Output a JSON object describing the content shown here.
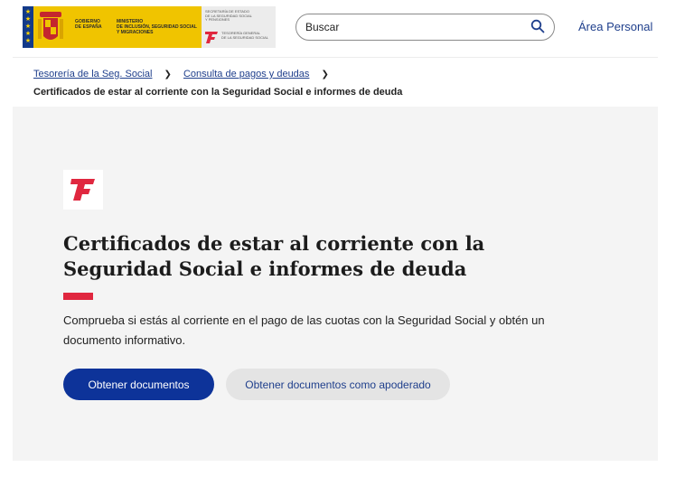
{
  "header": {
    "gobierno_text": [
      "GOBIERNO",
      "DE ESPAÑA"
    ],
    "ministerio_text": [
      "MINISTERIO",
      "DE INCLUSIÓN, SEGURIDAD SOCIAL",
      "Y MIGRACIONES"
    ],
    "secretaria_text": [
      "SECRETARÍA DE ESTADO",
      "DE LA SEGURIDAD SOCIAL",
      "Y PENSIONES"
    ],
    "tesoreria_text": [
      "TESORERÍA GENERAL",
      "DE LA SEGURIDAD SOCIAL"
    ],
    "search_placeholder": "Buscar",
    "area_personal": "Área Personal"
  },
  "breadcrumb": {
    "items": [
      "Tesorería de la Seg. Social",
      "Consulta de pagos y deudas"
    ],
    "current": "Certificados de estar al corriente con la Seguridad Social e informes de deuda"
  },
  "hero": {
    "title": "Certificados de estar al corriente con la Seguridad Social e informes de deuda",
    "description": "Comprueba si estás al corriente en el pago de las cuotas con la Seguridad Social y obtén un documento informativo.",
    "primary_button": "Obtener documentos",
    "secondary_button": "Obtener documentos como apoderado"
  },
  "colors": {
    "brand_blue": "#0d3399",
    "link_blue": "#1f3f8c",
    "accent_red": "#e0273f",
    "gov_yellow": "#f0c400"
  },
  "icons": [
    "coat-of-arms-icon",
    "tgss-logo-icon",
    "search-icon",
    "chevron-right-icon"
  ]
}
